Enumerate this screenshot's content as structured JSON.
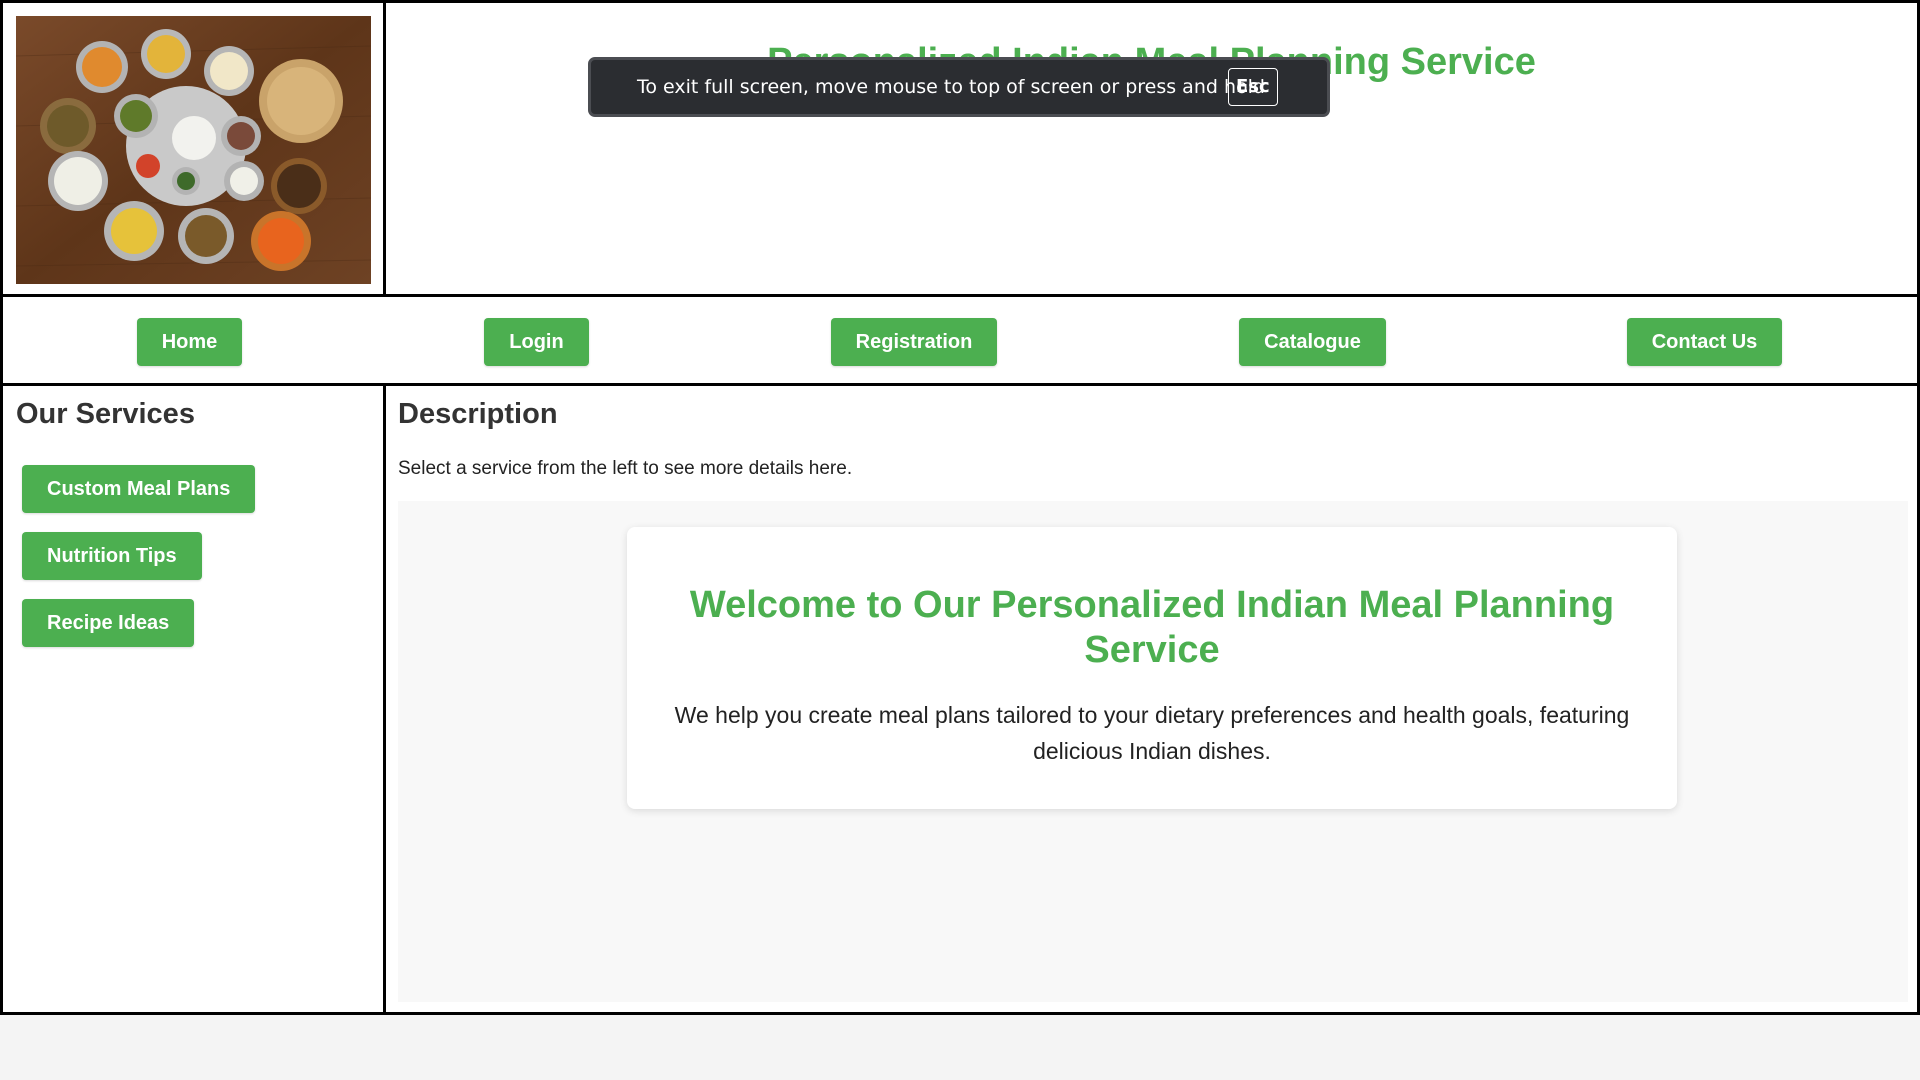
{
  "header": {
    "site_title": "Personalized Indian Meal Planning Service",
    "logo_image": "indian-thali-food-photo"
  },
  "nav": {
    "items": [
      {
        "label": "Home"
      },
      {
        "label": "Login"
      },
      {
        "label": "Registration"
      },
      {
        "label": "Catalogue"
      },
      {
        "label": "Contact Us"
      }
    ]
  },
  "sidebar": {
    "heading": "Our Services",
    "services": [
      {
        "label": "Custom Meal Plans"
      },
      {
        "label": "Nutrition Tips"
      },
      {
        "label": "Recipe Ideas"
      }
    ]
  },
  "main": {
    "heading": "Description",
    "instructions": "Select a service from the left to see more details here.",
    "welcome": {
      "title": "Welcome to Our Personalized Indian Meal Planning Service",
      "text": "We help you create meal plans tailored to your dietary preferences and health goals, featuring delicious Indian dishes."
    }
  },
  "fullscreen_notice": {
    "message": "To exit full screen, move mouse to top of screen or press and hold",
    "key": "Esc"
  },
  "colors": {
    "accent": "#4caf50",
    "border": "#000000",
    "toast_bg": "#2b2d31"
  }
}
